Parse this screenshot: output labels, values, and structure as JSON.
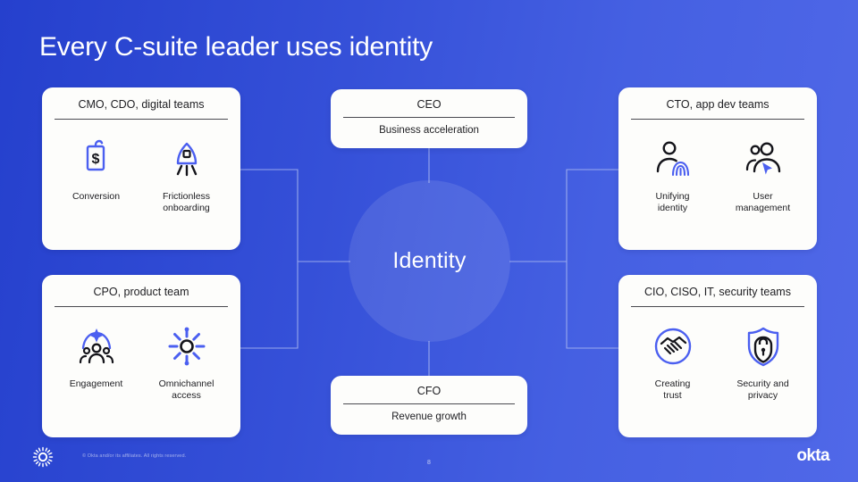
{
  "slide": {
    "title": "Every C-suite leader uses identity",
    "page_number": "8",
    "brand": "okta",
    "copyright": "© Okta and/or its affiliates. All rights reserved.",
    "accent_blue": "#4560e2",
    "icon_blue": "#4b5ff0",
    "card_bg": "#fdfdfb",
    "bg_gradient_from": "#2540cd",
    "bg_gradient_to": "#5068e8"
  },
  "center": {
    "label": "Identity"
  },
  "cards": {
    "top": {
      "title": "CEO",
      "subtitle": "Business acceleration"
    },
    "bottom": {
      "title": "CFO",
      "subtitle": "Revenue growth"
    },
    "top_left": {
      "title": "CMO, CDO, digital teams",
      "items": [
        {
          "icon": "price-tag-dollar-icon",
          "caption": "Conversion"
        },
        {
          "icon": "rocket-icon",
          "caption": "Frictionless\nonboarding"
        }
      ]
    },
    "bottom_left": {
      "title": "CPO, product team",
      "items": [
        {
          "icon": "people-sparkle-icon",
          "caption": "Engagement"
        },
        {
          "icon": "omnichannel-hub-icon",
          "caption": "Omnichannel\naccess"
        }
      ]
    },
    "top_right": {
      "title": "CTO, app dev teams",
      "items": [
        {
          "icon": "person-fingerprint-icon",
          "caption": "Unifying\nidentity"
        },
        {
          "icon": "users-cursor-icon",
          "caption": "User\nmanagement"
        }
      ]
    },
    "bottom_right": {
      "title": "CIO, CISO, IT, security teams",
      "items": [
        {
          "icon": "handshake-circle-icon",
          "caption": "Creating\ntrust"
        },
        {
          "icon": "shield-lock-icon",
          "caption": "Security and\nprivacy"
        }
      ]
    }
  }
}
